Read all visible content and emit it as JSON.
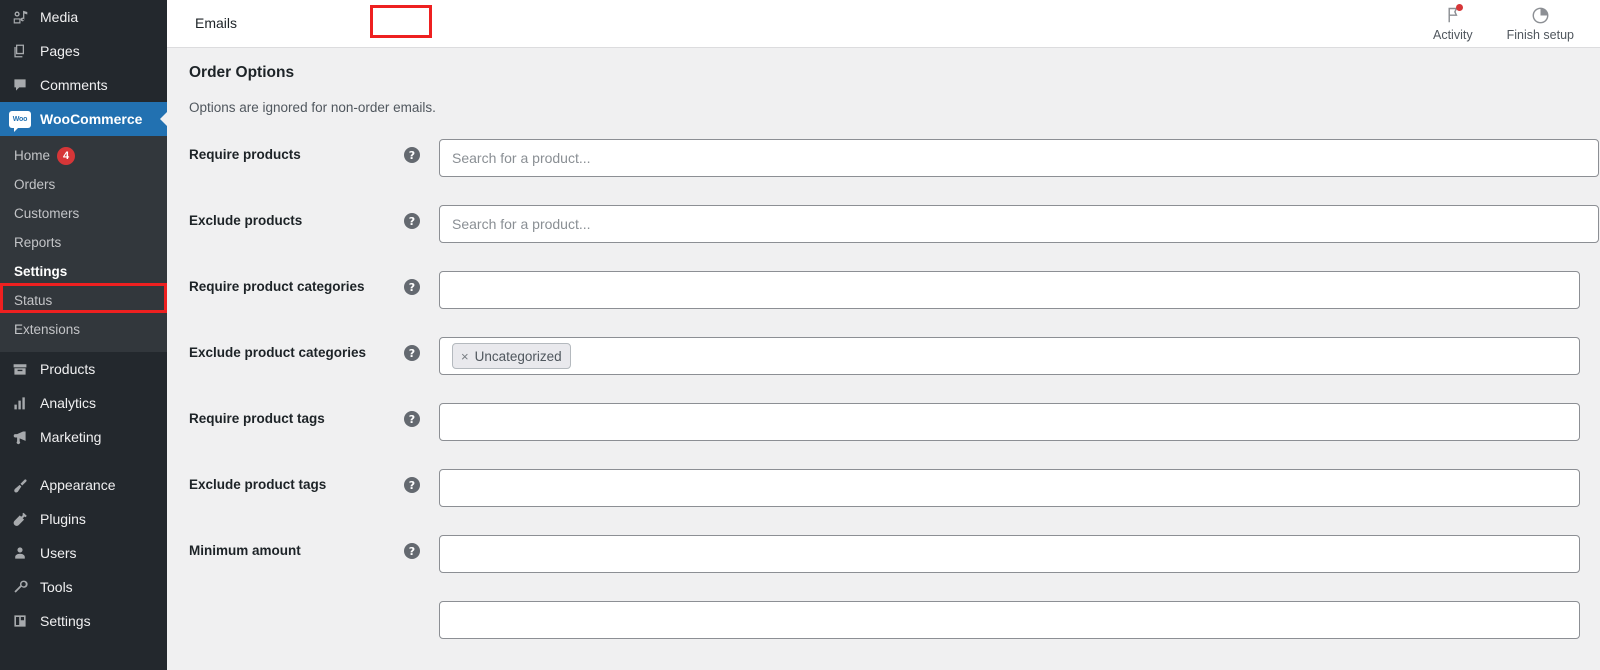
{
  "sidebar": {
    "top_items": [
      {
        "label": "Media",
        "icon": "media-icon"
      },
      {
        "label": "Pages",
        "icon": "pages-icon"
      },
      {
        "label": "Comments",
        "icon": "comments-icon"
      }
    ],
    "current_item": {
      "label": "WooCommerce",
      "icon": "woocommerce-icon",
      "logo_text": "Woo"
    },
    "submenu": [
      {
        "label": "Home",
        "badge": "4",
        "active": false
      },
      {
        "label": "Orders",
        "badge": null,
        "active": false
      },
      {
        "label": "Customers",
        "badge": null,
        "active": false
      },
      {
        "label": "Reports",
        "badge": null,
        "active": false
      },
      {
        "label": "Settings",
        "badge": null,
        "active": true
      },
      {
        "label": "Status",
        "badge": null,
        "active": false
      },
      {
        "label": "Extensions",
        "badge": null,
        "active": false
      }
    ],
    "group_two": [
      {
        "label": "Products",
        "icon": "products-icon"
      },
      {
        "label": "Analytics",
        "icon": "analytics-icon"
      },
      {
        "label": "Marketing",
        "icon": "marketing-icon"
      }
    ],
    "group_three": [
      {
        "label": "Appearance",
        "icon": "appearance-icon"
      },
      {
        "label": "Plugins",
        "icon": "plugins-icon"
      },
      {
        "label": "Users",
        "icon": "users-icon"
      },
      {
        "label": "Tools",
        "icon": "tools-icon"
      },
      {
        "label": "Settings",
        "icon": "settings-icon"
      }
    ]
  },
  "header": {
    "tabs": [
      {
        "label": "Emails",
        "active": true,
        "annotated": true
      }
    ],
    "actions": [
      {
        "label": "Activity",
        "icon": "flag-icon",
        "has_notification": true
      },
      {
        "label": "Finish setup",
        "icon": "pie-progress-icon",
        "has_notification": false
      }
    ]
  },
  "main": {
    "section_title": "Order Options",
    "section_description": "Options are ignored for non-order emails.",
    "fields": [
      {
        "label": "Require products",
        "help": "?",
        "placeholder": "Search for a product...",
        "value": "",
        "width": "wide",
        "chips": []
      },
      {
        "label": "Exclude products",
        "help": "?",
        "placeholder": "Search for a product...",
        "value": "",
        "width": "wide",
        "chips": []
      },
      {
        "label": "Require product categories",
        "help": "?",
        "placeholder": "",
        "value": "",
        "width": "narrow",
        "chips": []
      },
      {
        "label": "Exclude product categories",
        "help": "?",
        "placeholder": "",
        "value": "",
        "width": "narrow",
        "chips": [
          {
            "label": "Uncategorized",
            "remove": "×"
          }
        ]
      },
      {
        "label": "Require product tags",
        "help": "?",
        "placeholder": "",
        "value": "",
        "width": "narrow",
        "chips": []
      },
      {
        "label": "Exclude product tags",
        "help": "?",
        "placeholder": "",
        "value": "",
        "width": "narrow",
        "chips": []
      },
      {
        "label": "Minimum amount",
        "help": "?",
        "placeholder": "",
        "value": "",
        "width": "narrow",
        "chips": []
      }
    ]
  },
  "colors": {
    "sidebar_bg": "#23282d",
    "submenu_bg": "#32373c",
    "accent_blue": "#2271b1",
    "annotation_red": "#ee2020",
    "badge_red": "#d63638",
    "content_bg": "#f0f0f1"
  }
}
